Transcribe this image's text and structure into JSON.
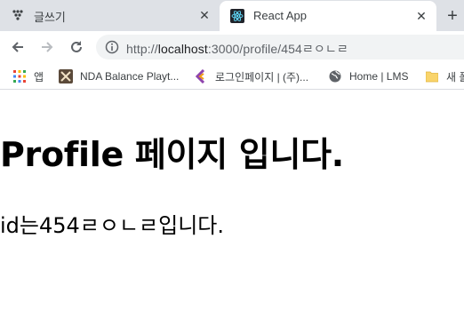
{
  "tabs": [
    {
      "title": "글쓰기",
      "icon": "dots-favicon-icon"
    },
    {
      "title": "React App",
      "icon": "react-favicon-icon",
      "active": true
    }
  ],
  "toolbar": {
    "url_protocol": "http://",
    "url_host": "localhost",
    "url_rest": ":3000/profile/454ㄹㅇㄴㄹ"
  },
  "bookmarks": [
    {
      "label": "앱",
      "icon": "apps-grid-icon"
    },
    {
      "label": "NDA Balance Playt...",
      "icon": "nda-favicon-icon"
    },
    {
      "label": "로그인페이지 | (주)...",
      "icon": "login-favicon-icon"
    },
    {
      "label": "Home | LMS",
      "icon": "globe-icon"
    },
    {
      "label": "새 폴",
      "icon": "folder-icon"
    }
  ],
  "page": {
    "heading": "Profile 페이지 입니다.",
    "text": "id는454ㄹㅇㄴㄹ입니다."
  },
  "colors": {
    "tabstrip": "#dee1e6",
    "omnibox": "#f1f3f4",
    "react_logo": "#61dafb"
  }
}
